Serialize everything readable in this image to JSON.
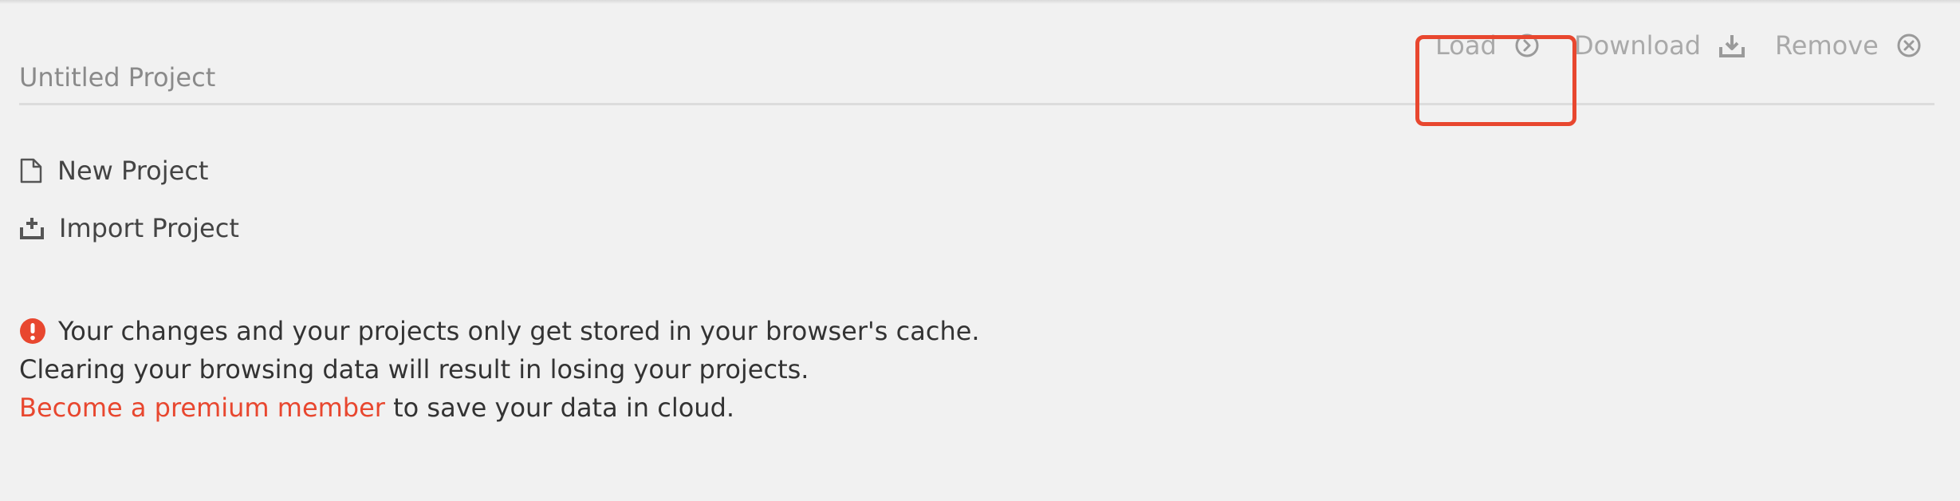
{
  "project": {
    "name": "Untitled Project"
  },
  "actions": {
    "load": {
      "label": "Load",
      "icon": "chevron-right-circle-icon"
    },
    "download": {
      "label": "Download",
      "icon": "download-tray-icon"
    },
    "remove": {
      "label": "Remove",
      "icon": "close-circle-icon"
    }
  },
  "menu": {
    "new_project": {
      "label": "New Project",
      "icon": "file-icon"
    },
    "import_project": {
      "label": "Import Project",
      "icon": "import-tray-icon"
    }
  },
  "notice": {
    "icon": "alert-icon",
    "line1": "Your changes and your projects only get stored in your browser's cache.",
    "line2": "Clearing your browsing data will result in losing your projects.",
    "link_text": "Become a premium member",
    "line3_rest": " to save your data in cloud."
  },
  "colors": {
    "accent": "#e8472f",
    "background": "#f1f1f1",
    "muted": "#a9a9a9"
  }
}
